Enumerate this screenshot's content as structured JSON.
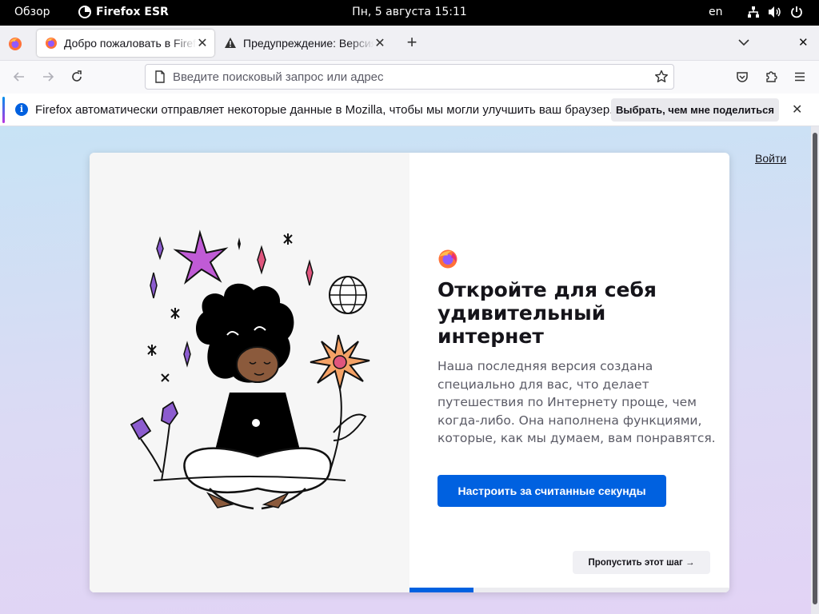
{
  "topbar": {
    "overview": "Обзор",
    "app_name": "Firefox ESR",
    "clock": "Пн, 5 августа  15:11",
    "lang": "en",
    "tray_icons": [
      "network-icon",
      "volume-icon",
      "power-icon"
    ]
  },
  "tabs": [
    {
      "title": "Добро пожаловать в Firefox",
      "icon": "firefox-icon",
      "active": true
    },
    {
      "title": "Предупреждение: Версия",
      "icon": "warning-icon",
      "active": false
    }
  ],
  "urlbar": {
    "placeholder": "Введите поисковый запрос или адрес"
  },
  "notification": {
    "message": "Firefox автоматически отправляет некоторые данные в Mozilla, чтобы мы могли улучшить ваш браузер.",
    "button": "Выбрать, чем мне поделиться"
  },
  "page": {
    "signin": "Войти",
    "heading": "Откройте для себя удивительный интернет",
    "subtext": "Наша последняя версия создана специально для вас, что делает путешествия по Интернету проще, чем когда-либо. Она наполнена функциями, которые, как мы думаем, вам понравятся.",
    "primary_button": "Настроить за считанные секунды",
    "skip_button": "Пропустить этот шаг →",
    "progress": 0.2
  },
  "colors": {
    "accent": "#0061e0",
    "background_top": "#c7e3f5",
    "background_bottom": "#e2d3f5"
  }
}
